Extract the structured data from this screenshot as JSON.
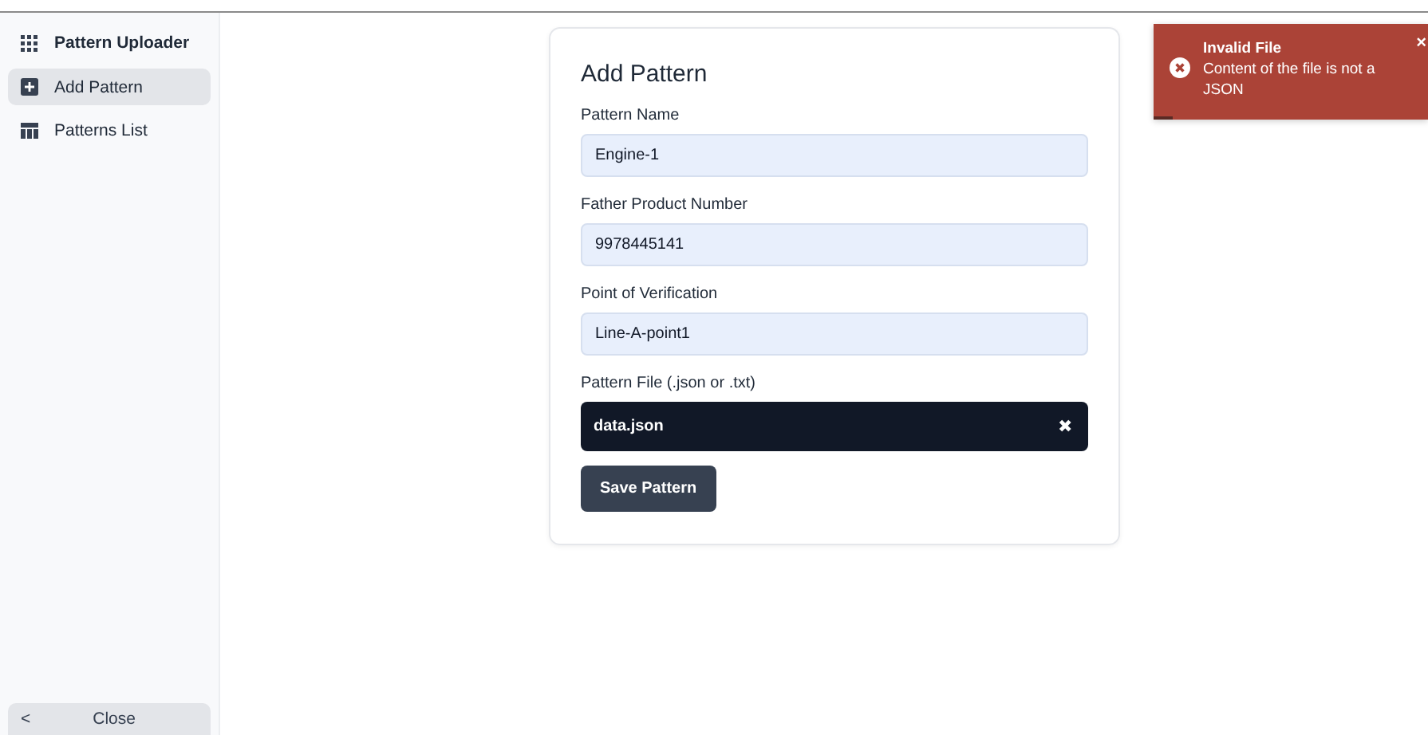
{
  "sidebar": {
    "title": "Pattern Uploader",
    "items": [
      {
        "label": "Add Pattern",
        "kind": "add",
        "selected": true
      },
      {
        "label": "Patterns List",
        "kind": "table",
        "selected": false
      }
    ],
    "close_button": {
      "icon": "<",
      "label": "Close"
    }
  },
  "form": {
    "title": "Add Pattern",
    "fields": [
      {
        "label": "Pattern Name",
        "value": "Engine-1"
      },
      {
        "label": "Father Product Number",
        "value": "9978445141"
      },
      {
        "label": "Point of Verification",
        "value": "Line-A-point1"
      }
    ],
    "file": {
      "label": "Pattern File (.json or .txt)",
      "filename": "data.json",
      "remove": "✖"
    },
    "submit": "Save Pattern"
  },
  "toast": {
    "title": "Invalid File",
    "message": "Content of the file is not a JSON",
    "close": "×",
    "level": 0.07
  }
}
